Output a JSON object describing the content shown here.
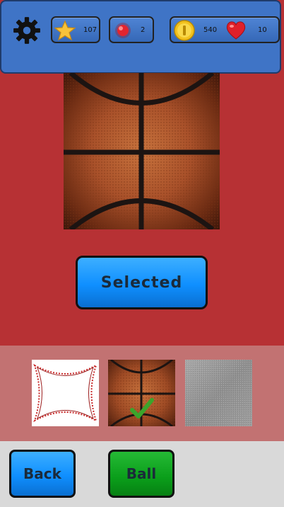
{
  "header": {
    "stars": "107",
    "gems": "2",
    "coins": "540",
    "lives": "10"
  },
  "main": {
    "selected_label": "Selected"
  },
  "picker": {
    "items": [
      {
        "name": "baseball"
      },
      {
        "name": "basketball",
        "checked": true
      },
      {
        "name": "metal"
      }
    ]
  },
  "footer": {
    "back_label": "Back",
    "ball_label": "Ball"
  },
  "colors": {
    "background": "#b73134",
    "topbar": "#3f74c6",
    "button_blue": "#0f8fff",
    "button_green": "#0a9e1a",
    "checkmark": "#3ba52b"
  }
}
